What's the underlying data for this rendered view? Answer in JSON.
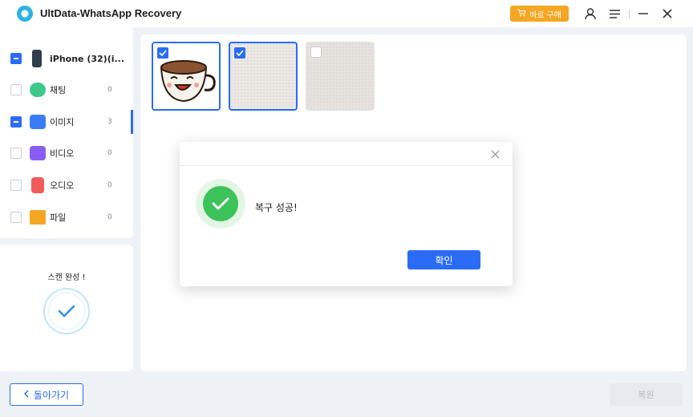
{
  "app": {
    "title": "UltData-WhatsApp Recovery",
    "buy_label": "바로 구매"
  },
  "sidebar": {
    "device": {
      "label": "iPhone (32)(i..."
    },
    "items": [
      {
        "label": "채팅",
        "count": "0",
        "icon": "chat-icon",
        "color": "#3ec98a"
      },
      {
        "label": "이미지",
        "count": "3",
        "icon": "image-icon",
        "color": "#3b7cf6"
      },
      {
        "label": "비디오",
        "count": "0",
        "icon": "video-icon",
        "color": "#8a5cf6"
      },
      {
        "label": "오디오",
        "count": "0",
        "icon": "music-icon",
        "color": "#f25a5a"
      },
      {
        "label": "파일",
        "count": "0",
        "icon": "folder-icon",
        "color": "#f5a623"
      }
    ]
  },
  "scan": {
    "label": "스캔 완성 !"
  },
  "dialog": {
    "message": "복구 성공!",
    "confirm_label": "확인"
  },
  "footer": {
    "back_label": "돌아가기",
    "recover_label": "복원"
  },
  "colors": {
    "accent": "#2a6cf6",
    "buy": "#f5a623",
    "success": "#3cc35a"
  }
}
